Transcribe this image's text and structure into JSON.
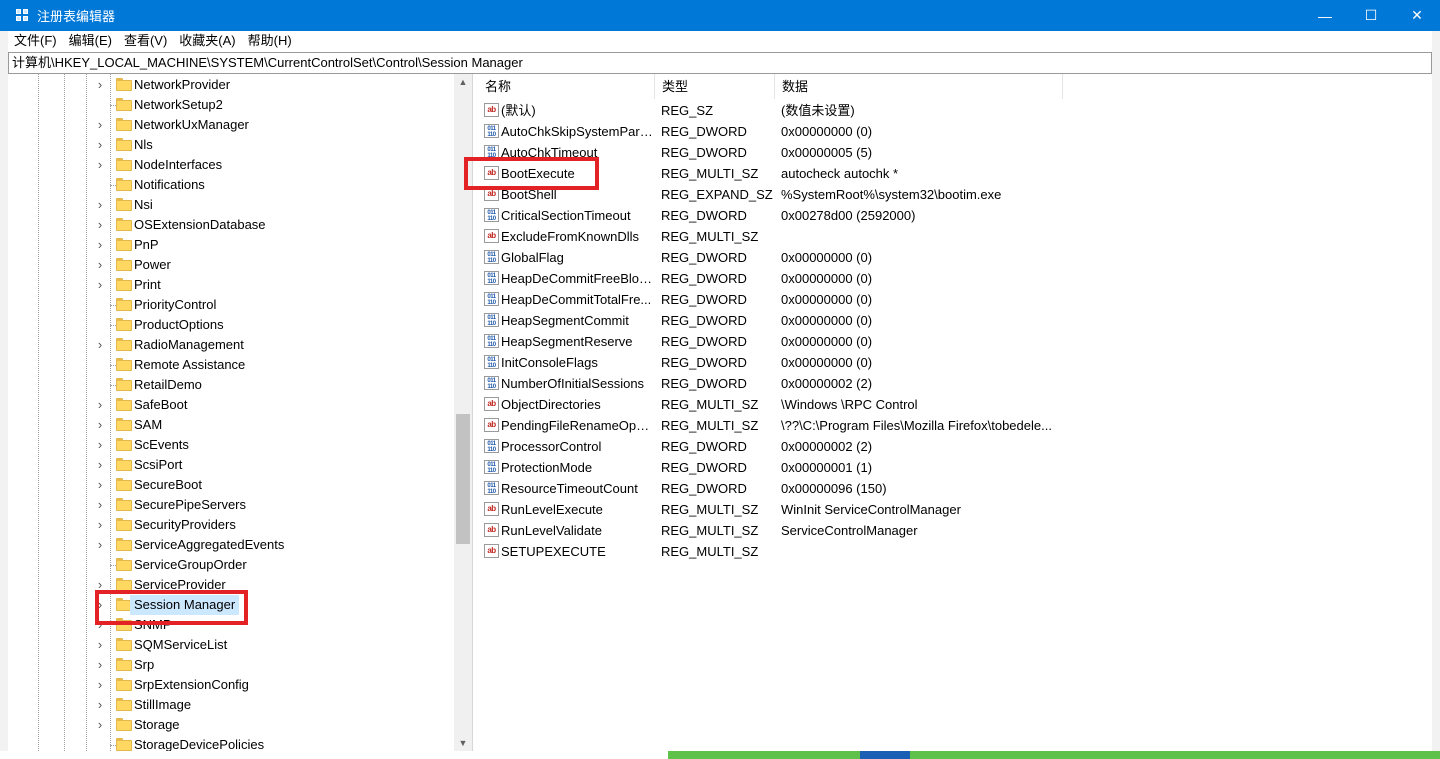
{
  "window": {
    "title": "注册表编辑器",
    "controls": {
      "minimize": "—",
      "maximize": "☐",
      "close": "✕"
    }
  },
  "menu": [
    "文件(F)",
    "编辑(E)",
    "查看(V)",
    "收藏夹(A)",
    "帮助(H)"
  ],
  "address": "计算机\\HKEY_LOCAL_MACHINE\\SYSTEM\\CurrentControlSet\\Control\\Session Manager",
  "tree": {
    "items": [
      {
        "label": "NetworkProvider",
        "expandable": true
      },
      {
        "label": "NetworkSetup2",
        "expandable": false
      },
      {
        "label": "NetworkUxManager",
        "expandable": true
      },
      {
        "label": "Nls",
        "expandable": true
      },
      {
        "label": "NodeInterfaces",
        "expandable": true
      },
      {
        "label": "Notifications",
        "expandable": false
      },
      {
        "label": "Nsi",
        "expandable": true
      },
      {
        "label": "OSExtensionDatabase",
        "expandable": true
      },
      {
        "label": "PnP",
        "expandable": true
      },
      {
        "label": "Power",
        "expandable": true
      },
      {
        "label": "Print",
        "expandable": true
      },
      {
        "label": "PriorityControl",
        "expandable": false
      },
      {
        "label": "ProductOptions",
        "expandable": false
      },
      {
        "label": "RadioManagement",
        "expandable": true
      },
      {
        "label": "Remote Assistance",
        "expandable": false
      },
      {
        "label": "RetailDemo",
        "expandable": false
      },
      {
        "label": "SafeBoot",
        "expandable": true
      },
      {
        "label": "SAM",
        "expandable": true
      },
      {
        "label": "ScEvents",
        "expandable": true
      },
      {
        "label": "ScsiPort",
        "expandable": true
      },
      {
        "label": "SecureBoot",
        "expandable": true
      },
      {
        "label": "SecurePipeServers",
        "expandable": true
      },
      {
        "label": "SecurityProviders",
        "expandable": true
      },
      {
        "label": "ServiceAggregatedEvents",
        "expandable": true
      },
      {
        "label": "ServiceGroupOrder",
        "expandable": false
      },
      {
        "label": "ServiceProvider",
        "expandable": true
      },
      {
        "label": "Session Manager",
        "expandable": true,
        "selected": true
      },
      {
        "label": "SNMP",
        "expandable": true
      },
      {
        "label": "SQMServiceList",
        "expandable": true
      },
      {
        "label": "Srp",
        "expandable": true
      },
      {
        "label": "SrpExtensionConfig",
        "expandable": true
      },
      {
        "label": "StillImage",
        "expandable": true
      },
      {
        "label": "Storage",
        "expandable": true
      },
      {
        "label": "StorageDevicePolicies",
        "expandable": false
      }
    ]
  },
  "list": {
    "columns": [
      "名称",
      "类型",
      "数据"
    ],
    "rows": [
      {
        "icon": "ab",
        "name": "(默认)",
        "type": "REG_SZ",
        "data": "(数值未设置)"
      },
      {
        "icon": "bin",
        "name": "AutoChkSkipSystemParti...",
        "type": "REG_DWORD",
        "data": "0x00000000 (0)"
      },
      {
        "icon": "bin",
        "name": "AutoChkTimeout",
        "type": "REG_DWORD",
        "data": "0x00000005 (5)"
      },
      {
        "icon": "ab",
        "name": "BootExecute",
        "type": "REG_MULTI_SZ",
        "data": "autocheck autochk *"
      },
      {
        "icon": "ab",
        "name": "BootShell",
        "type": "REG_EXPAND_SZ",
        "data": "%SystemRoot%\\system32\\bootim.exe"
      },
      {
        "icon": "bin",
        "name": "CriticalSectionTimeout",
        "type": "REG_DWORD",
        "data": "0x00278d00 (2592000)"
      },
      {
        "icon": "ab",
        "name": "ExcludeFromKnownDlls",
        "type": "REG_MULTI_SZ",
        "data": ""
      },
      {
        "icon": "bin",
        "name": "GlobalFlag",
        "type": "REG_DWORD",
        "data": "0x00000000 (0)"
      },
      {
        "icon": "bin",
        "name": "HeapDeCommitFreeBloc...",
        "type": "REG_DWORD",
        "data": "0x00000000 (0)"
      },
      {
        "icon": "bin",
        "name": "HeapDeCommitTotalFre...",
        "type": "REG_DWORD",
        "data": "0x00000000 (0)"
      },
      {
        "icon": "bin",
        "name": "HeapSegmentCommit",
        "type": "REG_DWORD",
        "data": "0x00000000 (0)"
      },
      {
        "icon": "bin",
        "name": "HeapSegmentReserve",
        "type": "REG_DWORD",
        "data": "0x00000000 (0)"
      },
      {
        "icon": "bin",
        "name": "InitConsoleFlags",
        "type": "REG_DWORD",
        "data": "0x00000000 (0)"
      },
      {
        "icon": "bin",
        "name": "NumberOfInitialSessions",
        "type": "REG_DWORD",
        "data": "0x00000002 (2)"
      },
      {
        "icon": "ab",
        "name": "ObjectDirectories",
        "type": "REG_MULTI_SZ",
        "data": "\\Windows \\RPC Control"
      },
      {
        "icon": "ab",
        "name": "PendingFileRenameOper...",
        "type": "REG_MULTI_SZ",
        "data": "\\??\\C:\\Program Files\\Mozilla Firefox\\tobedele..."
      },
      {
        "icon": "bin",
        "name": "ProcessorControl",
        "type": "REG_DWORD",
        "data": "0x00000002 (2)"
      },
      {
        "icon": "bin",
        "name": "ProtectionMode",
        "type": "REG_DWORD",
        "data": "0x00000001 (1)"
      },
      {
        "icon": "bin",
        "name": "ResourceTimeoutCount",
        "type": "REG_DWORD",
        "data": "0x00000096 (150)"
      },
      {
        "icon": "ab",
        "name": "RunLevelExecute",
        "type": "REG_MULTI_SZ",
        "data": "WinInit ServiceControlManager"
      },
      {
        "icon": "ab",
        "name": "RunLevelValidate",
        "type": "REG_MULTI_SZ",
        "data": "ServiceControlManager"
      },
      {
        "icon": "ab",
        "name": "SETUPEXECUTE",
        "type": "REG_MULTI_SZ",
        "data": ""
      }
    ]
  },
  "icons": {
    "string_value": "ab",
    "binary_value": "011\n110"
  },
  "colors": {
    "titlebar": "#0078d7",
    "highlight": "#e32226",
    "selection": "#cce8ff",
    "folder": "#ffd862"
  }
}
